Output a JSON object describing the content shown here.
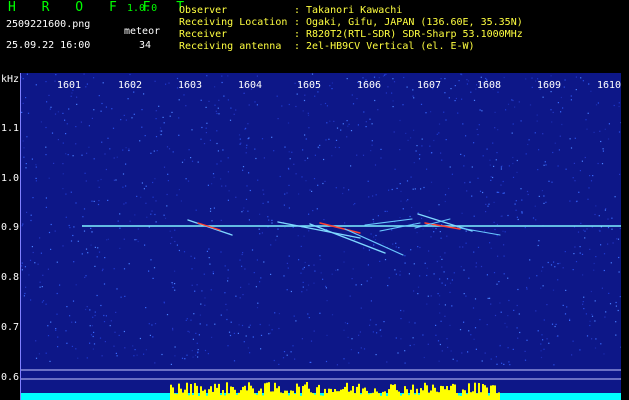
{
  "header": {
    "app_title": "H R O F F T",
    "app_version": "1.0.0",
    "filename": "2509221600.png",
    "datetime": "25.09.22 16:00",
    "meteor_label": "meteor",
    "meteor_count": "34"
  },
  "info": [
    {
      "key": "Observer",
      "sep": ":",
      "value": "Takanori Kawachi"
    },
    {
      "key": "Receiving Location",
      "sep": ":",
      "value": "Ogaki, Gifu, JAPAN (136.60E, 35.35N)"
    },
    {
      "key": "Receiver",
      "sep": ":",
      "value": "R820T2(RTL-SDR) SDR-Sharp 53.1000MHz"
    },
    {
      "key": "Receiving antenna",
      "sep": ":",
      "value": "2el-HB9CV Vertical (el. E-W)"
    }
  ],
  "spectrogram": {
    "y_unit": "kHz",
    "y_ticks": [
      "1.1",
      "1.0",
      "0.9",
      "0.8",
      "0.7",
      "0.6"
    ],
    "x_ticks": [
      "1601",
      "1602",
      "1603",
      "1604",
      "1605",
      "1606",
      "1607",
      "1608",
      "1609",
      "1610"
    ],
    "colors": {
      "background": "#101a8c",
      "carrier": "#60e0ff",
      "trail": "#70d0ff",
      "hot": "#ff3030",
      "level": "#ffff00",
      "level_base": "#00ffff"
    }
  }
}
